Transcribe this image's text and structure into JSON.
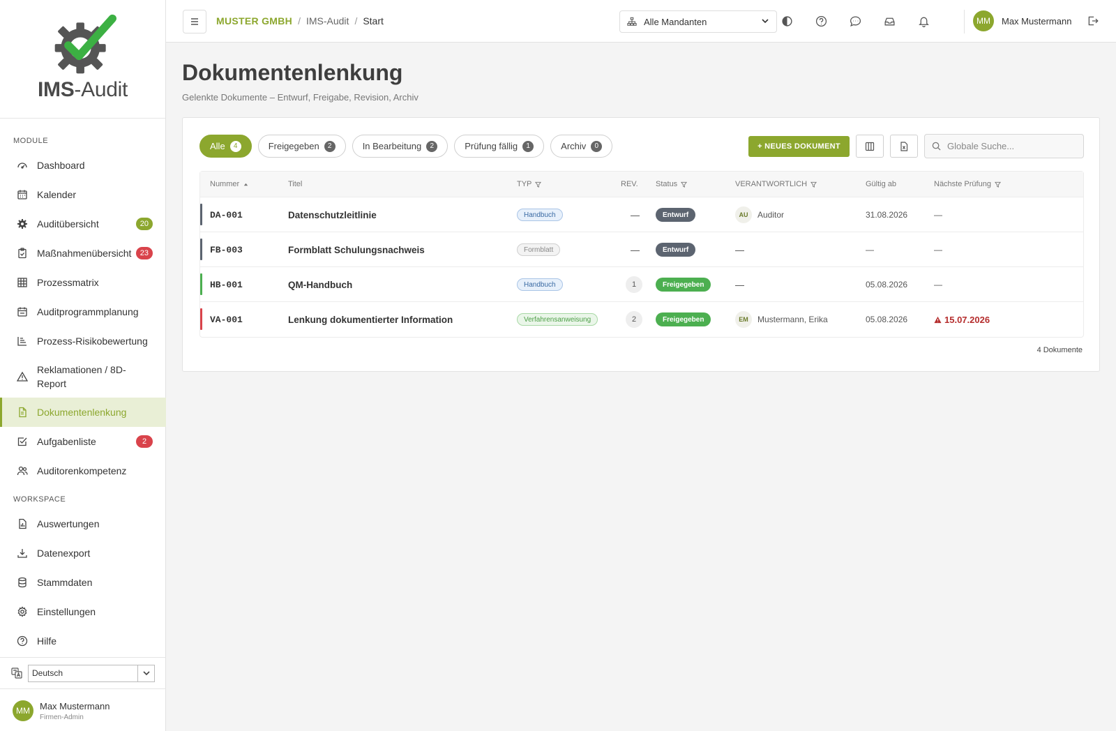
{
  "app": {
    "logo_bold": "IMS",
    "logo_rest": "-Audit"
  },
  "sidebar": {
    "section_module": "MODULE",
    "section_workspace": "WORKSPACE",
    "items": [
      {
        "label": "Dashboard"
      },
      {
        "label": "Kalender"
      },
      {
        "label": "Auditübersicht",
        "badge": "20"
      },
      {
        "label": "Maßnahmenübersicht",
        "badge": "23"
      },
      {
        "label": "Prozessmatrix"
      },
      {
        "label": "Auditprogrammplanung"
      },
      {
        "label": "Prozess-Risikobewertung"
      },
      {
        "label": "Reklamationen / 8D-Report"
      },
      {
        "label": "Dokumentenlenkung"
      },
      {
        "label": "Aufgabenliste",
        "badge": "2"
      },
      {
        "label": "Auditorenkompetenz"
      }
    ],
    "workspace_items": [
      {
        "label": "Auswertungen"
      },
      {
        "label": "Datenexport"
      },
      {
        "label": "Stammdaten"
      },
      {
        "label": "Einstellungen"
      },
      {
        "label": "Hilfe"
      }
    ],
    "language": "Deutsch",
    "user": {
      "initials": "MM",
      "name": "Max Mustermann",
      "role": "Firmen-Admin"
    }
  },
  "header": {
    "breadcrumb": {
      "company": "MUSTER GMBH",
      "module": "IMS-Audit",
      "current": "Start"
    },
    "mandant": "Alle Mandanten",
    "user": {
      "initials": "MM",
      "name": "Max Mustermann"
    }
  },
  "main": {
    "title": "Dokumentenlenkung",
    "subtitle": "Gelenkte Dokumente – Entwurf, Freigabe, Revision, Archiv",
    "filters": [
      {
        "label": "Alle",
        "count": "4"
      },
      {
        "label": "Freigegeben",
        "count": "2"
      },
      {
        "label": "In Bearbeitung",
        "count": "2"
      },
      {
        "label": "Prüfung fällig",
        "count": "1"
      },
      {
        "label": "Archiv",
        "count": "0"
      }
    ],
    "new_button": "+ NEUES DOKUMENT",
    "search_placeholder": "Globale Suche...",
    "columns": {
      "number": "Nummer",
      "title": "Titel",
      "type": "TYP",
      "rev": "REV.",
      "status": "Status",
      "responsible": "VERANTWORTLICH",
      "valid_from": "Gültig ab",
      "next_review": "Nächste Prüfung"
    },
    "rows": [
      {
        "number": "DA-001",
        "title": "Datenschutzleitlinie",
        "type": "Handbuch",
        "rev": "—",
        "status": "Entwurf",
        "resp_initials": "AU",
        "responsible": "Auditor",
        "valid_from": "31.08.2026",
        "next_review": "—"
      },
      {
        "number": "FB-003",
        "title": "Formblatt Schulungsnachweis",
        "type": "Formblatt",
        "rev": "—",
        "status": "Entwurf",
        "resp_initials": "",
        "responsible": "—",
        "valid_from": "—",
        "next_review": "—"
      },
      {
        "number": "HB-001",
        "title": "QM-Handbuch",
        "type": "Handbuch",
        "rev": "1",
        "status": "Freigegeben",
        "resp_initials": "",
        "responsible": "—",
        "valid_from": "05.08.2026",
        "next_review": "—"
      },
      {
        "number": "VA-001",
        "title": "Lenkung dokumentierter Information",
        "type": "Verfahrensanweisung",
        "rev": "2",
        "status": "Freigegeben",
        "resp_initials": "EM",
        "responsible": "Mustermann, Erika",
        "valid_from": "05.08.2026",
        "next_review": "15.07.2026"
      }
    ],
    "doc_count": "4 Dokumente"
  },
  "colors": {
    "accent": "#8ca72e",
    "danger": "#d9434b",
    "ok": "#4caf50",
    "draft": "#5c6470"
  }
}
